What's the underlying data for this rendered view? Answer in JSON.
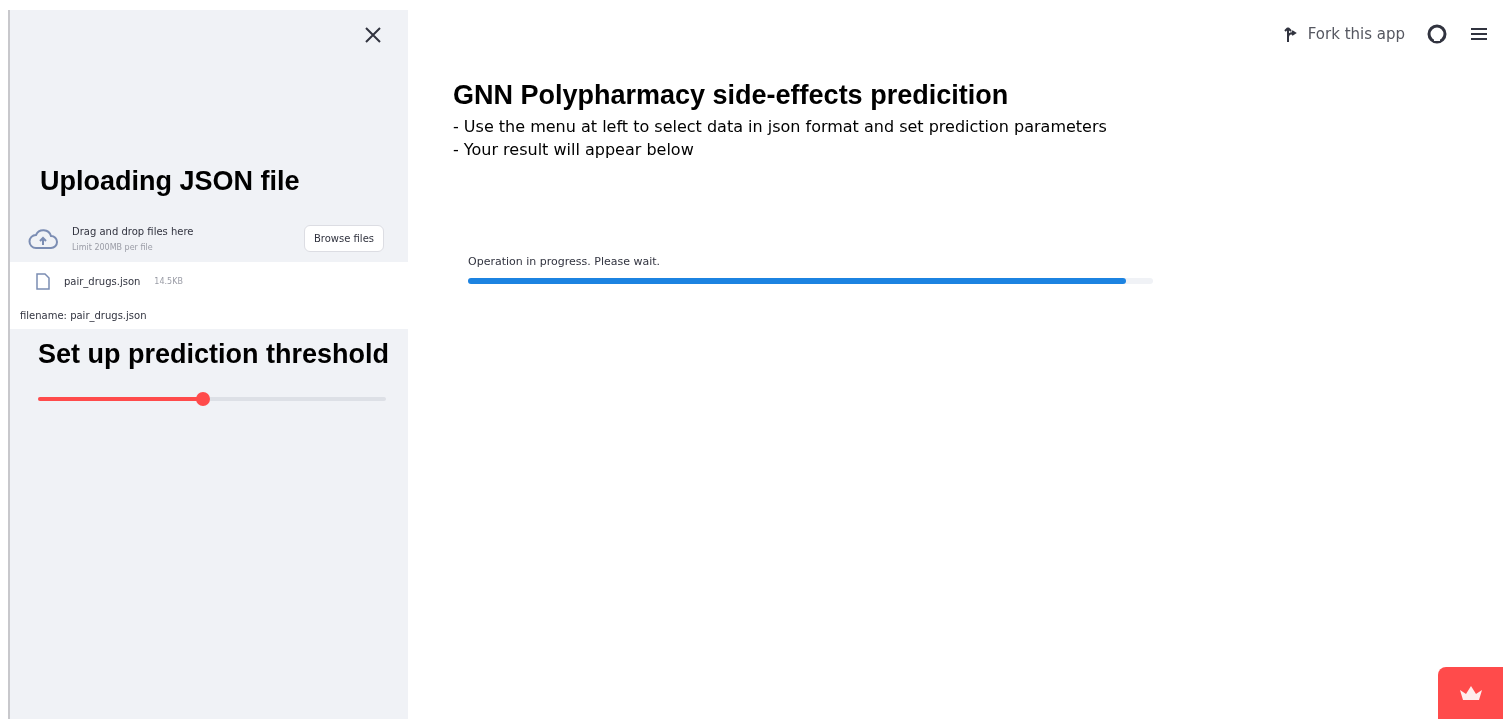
{
  "sidebar": {
    "upload": {
      "title": "Uploading JSON file",
      "dropzone": {
        "instruction": "Drag and drop files here",
        "limit": "Limit 200MB per file",
        "button": "Browse files"
      },
      "file": {
        "name": "pair_drugs.json",
        "size": "14.5KB"
      },
      "caption": "filename: pair_drugs.json"
    },
    "threshold": {
      "title": "Set up prediction threshold",
      "level": 0.475
    }
  },
  "header": {
    "fork_label": "Fork this app"
  },
  "main": {
    "title": "GNN Polypharmacy side-effects predicition",
    "lines": [
      "- Use the menu at left to select data in json format and set prediction parameters",
      "- Your result will appear below"
    ],
    "progress": {
      "label": "Operation in progress. Please wait.",
      "level": 0.96
    }
  }
}
